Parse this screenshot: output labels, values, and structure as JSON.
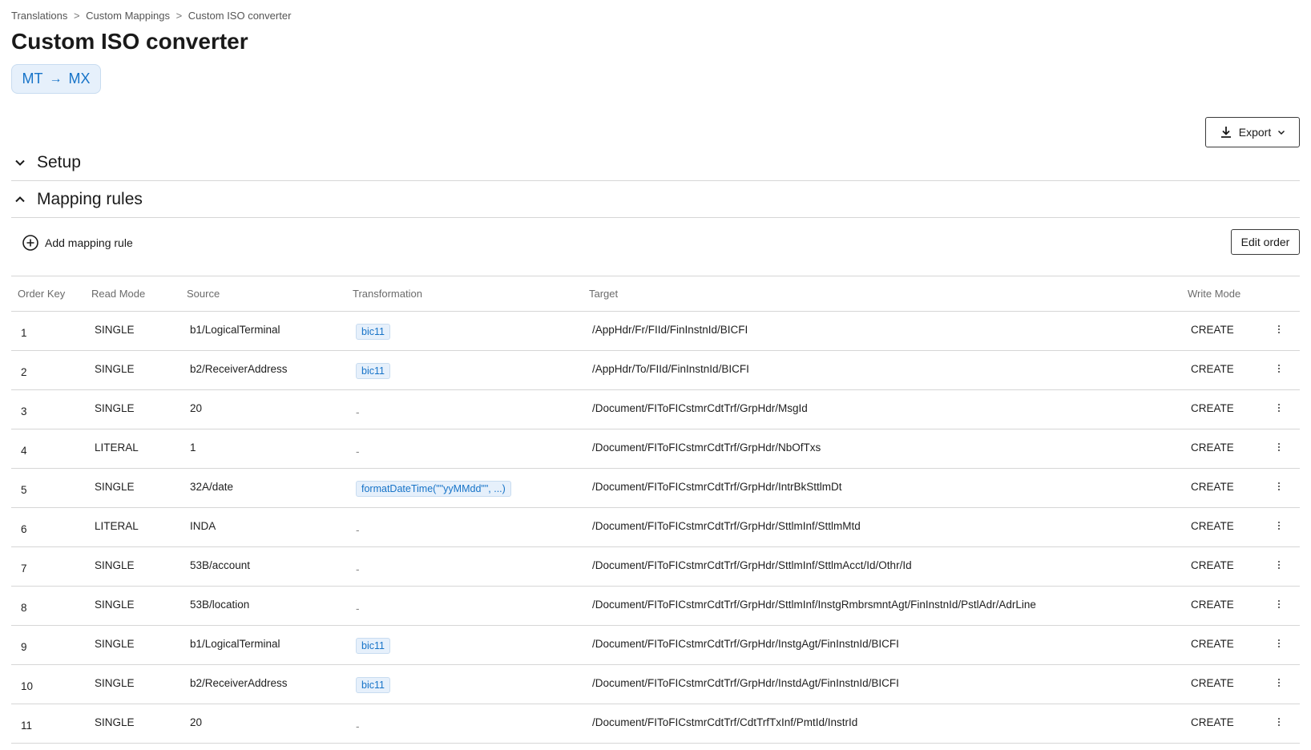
{
  "breadcrumb": [
    "Translations",
    "Custom Mappings",
    "Custom ISO converter"
  ],
  "breadcrumb_sep": ">",
  "title": "Custom ISO converter",
  "direction": {
    "from": "MT",
    "to": "MX",
    "arrow_icon": "arrow-right-icon"
  },
  "export_label": "Export",
  "sections": {
    "setup": "Setup",
    "mapping": "Mapping rules"
  },
  "add_rule_label": "Add mapping rule",
  "edit_order_label": "Edit order",
  "columns": [
    "Order Key",
    "Read Mode",
    "Source",
    "Transformation",
    "Target",
    "Write Mode"
  ],
  "rows": [
    {
      "order": "1",
      "read": "SINGLE",
      "source": "b1/LogicalTerminal",
      "trans": "bic11",
      "target": "/AppHdr/Fr/FIId/FinInstnId/BICFI",
      "write": "CREATE"
    },
    {
      "order": "2",
      "read": "SINGLE",
      "source": "b2/ReceiverAddress",
      "trans": "bic11",
      "target": "/AppHdr/To/FIId/FinInstnId/BICFI",
      "write": "CREATE"
    },
    {
      "order": "3",
      "read": "SINGLE",
      "source": "20",
      "trans": "-",
      "target": "/Document/FIToFICstmrCdtTrf/GrpHdr/MsgId",
      "write": "CREATE"
    },
    {
      "order": "4",
      "read": "LITERAL",
      "source": "1",
      "trans": "-",
      "target": "/Document/FIToFICstmrCdtTrf/GrpHdr/NbOfTxs",
      "write": "CREATE"
    },
    {
      "order": "5",
      "read": "SINGLE",
      "source": "32A/date",
      "trans": "formatDateTime(\"\"yyMMdd\"\", ...)",
      "target": "/Document/FIToFICstmrCdtTrf/GrpHdr/IntrBkSttlmDt",
      "write": "CREATE"
    },
    {
      "order": "6",
      "read": "LITERAL",
      "source": "INDA",
      "trans": "-",
      "target": "/Document/FIToFICstmrCdtTrf/GrpHdr/SttlmInf/SttlmMtd",
      "write": "CREATE"
    },
    {
      "order": "7",
      "read": "SINGLE",
      "source": "53B/account",
      "trans": "-",
      "target": "/Document/FIToFICstmrCdtTrf/GrpHdr/SttlmInf/SttlmAcct/Id/Othr/Id",
      "write": "CREATE"
    },
    {
      "order": "8",
      "read": "SINGLE",
      "source": "53B/location",
      "trans": "-",
      "target": "/Document/FIToFICstmrCdtTrf/GrpHdr/SttlmInf/InstgRmbrsmntAgt/FinInstnId/PstlAdr/AdrLine",
      "write": "CREATE"
    },
    {
      "order": "9",
      "read": "SINGLE",
      "source": "b1/LogicalTerminal",
      "trans": "bic11",
      "target": "/Document/FIToFICstmrCdtTrf/GrpHdr/InstgAgt/FinInstnId/BICFI",
      "write": "CREATE"
    },
    {
      "order": "10",
      "read": "SINGLE",
      "source": "b2/ReceiverAddress",
      "trans": "bic11",
      "target": "/Document/FIToFICstmrCdtTrf/GrpHdr/InstdAgt/FinInstnId/BICFI",
      "write": "CREATE"
    },
    {
      "order": "11",
      "read": "SINGLE",
      "source": "20",
      "trans": "-",
      "target": "/Document/FIToFICstmrCdtTrf/CdtTrfTxInf/PmtId/InstrId",
      "write": "CREATE"
    }
  ],
  "colors": {
    "accent": "#1673c8",
    "chip_bg": "#e6f0fb",
    "border": "#d6d6d6"
  }
}
